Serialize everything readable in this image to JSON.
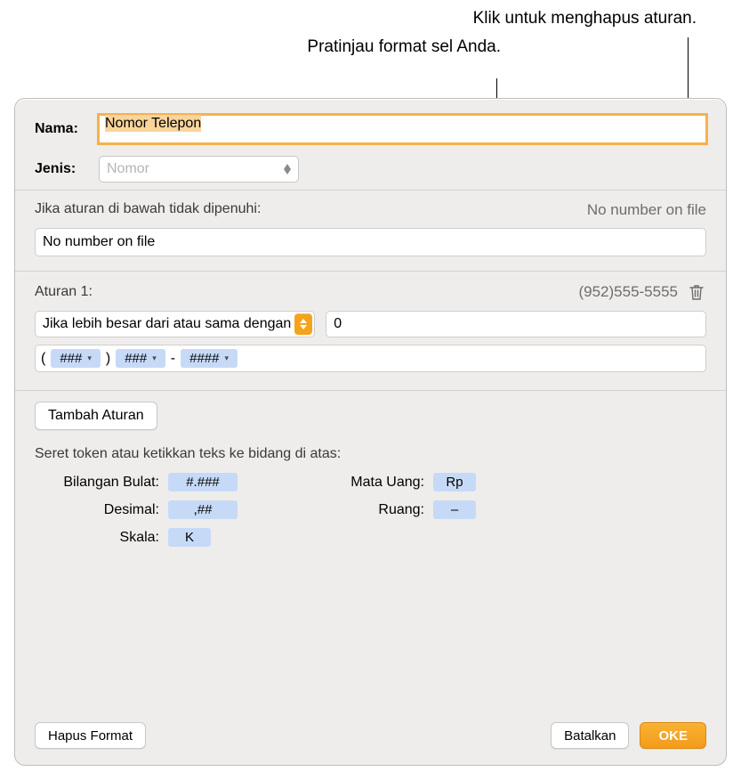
{
  "callouts": {
    "delete": "Klik untuk menghapus aturan.",
    "preview": "Pratinjau format sel Anda."
  },
  "fields": {
    "name_label": "Nama:",
    "name_value": "Nomor Telepon",
    "type_label": "Jenis:",
    "type_value": "Nomor"
  },
  "default_rule": {
    "label": "Jika aturan di bawah tidak dipenuhi:",
    "preview": "No number on file",
    "value": "No number on file"
  },
  "rule1": {
    "label": "Aturan 1:",
    "preview": "(952)555-5555",
    "condition": "Jika lebih besar dari atau sama dengan",
    "value": "0",
    "format": {
      "open": "(",
      "token1": "###",
      "close": ")",
      "token2": "###",
      "dash": "-",
      "token3": "####"
    }
  },
  "add_rule_label": "Tambah Aturan",
  "drag_hint": "Seret token atau ketikkan teks ke bidang di atas:",
  "token_samples": {
    "integer_label": "Bilangan Bulat:",
    "integer_token": "#.###",
    "decimal_label": "Desimal:",
    "decimal_token": ",##",
    "scale_label": "Skala:",
    "scale_token": "K",
    "currency_label": "Mata Uang:",
    "currency_token": "Rp",
    "space_label": "Ruang:",
    "space_token": "–"
  },
  "footer": {
    "delete_format": "Hapus Format",
    "cancel": "Batalkan",
    "ok": "OKE"
  },
  "icons": {
    "trash": "trash-icon"
  }
}
